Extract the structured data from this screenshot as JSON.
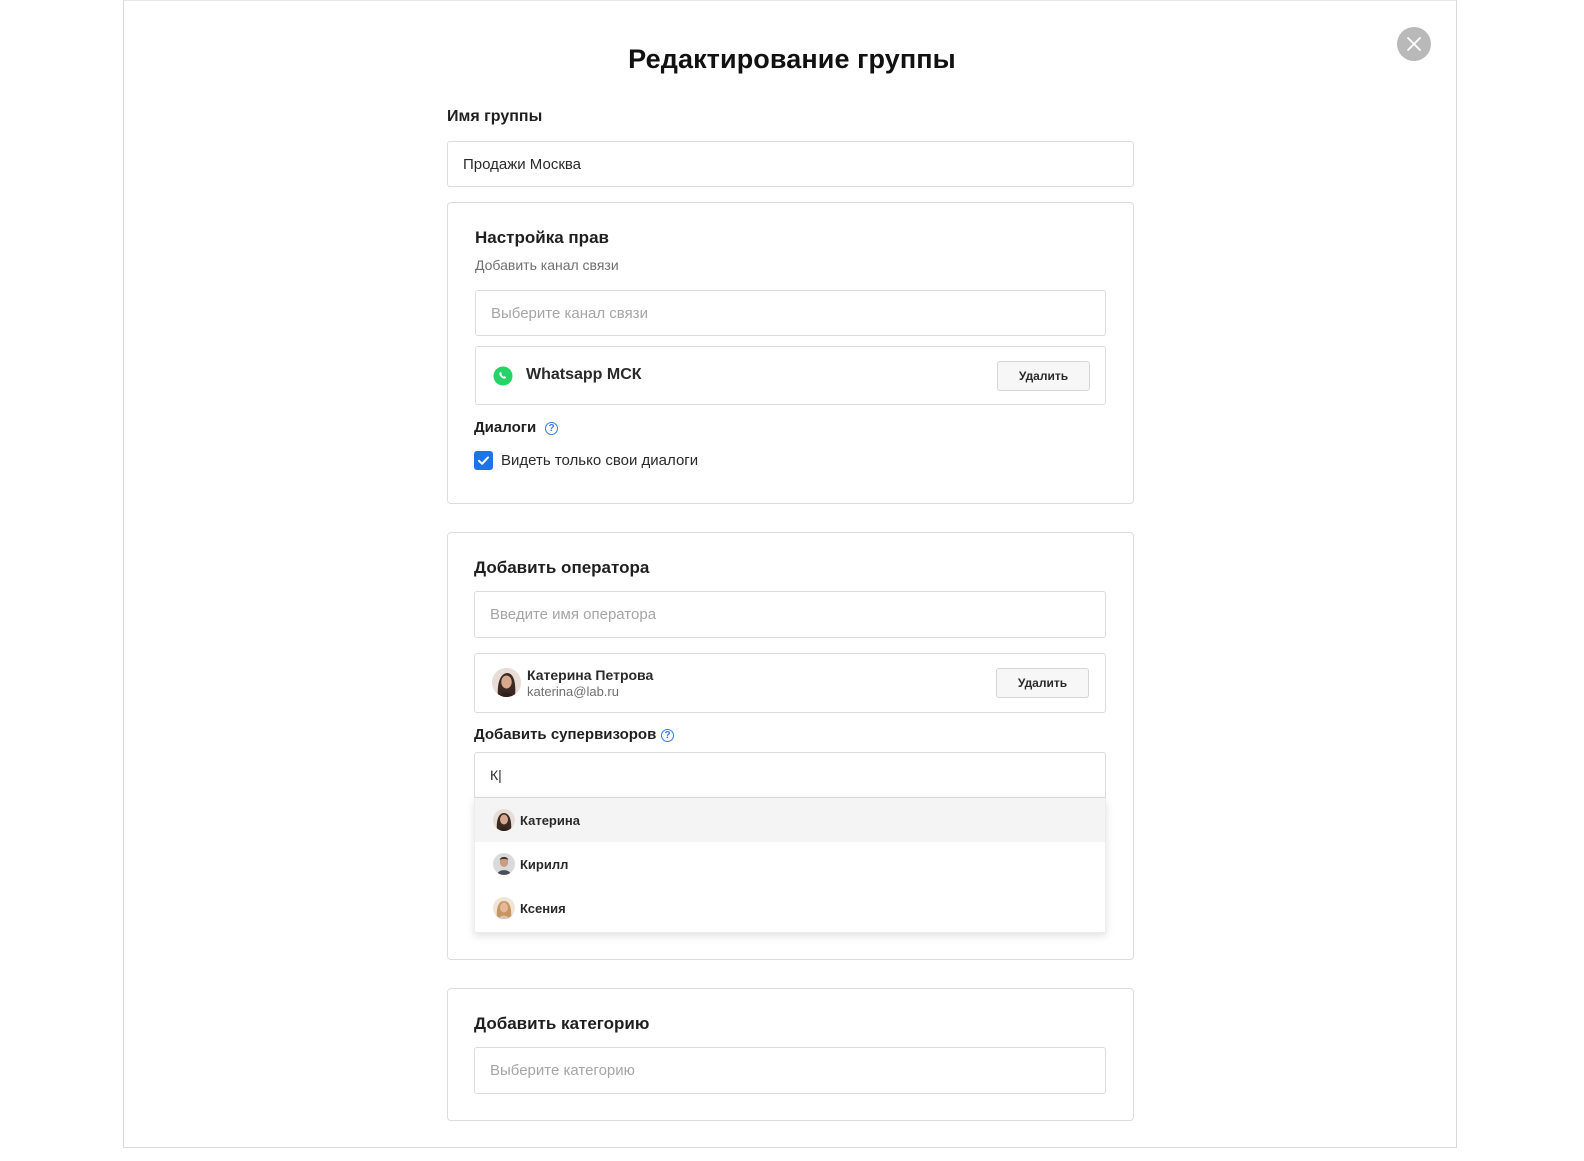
{
  "modal": {
    "title": "Редактирование группы",
    "close_icon": "close-icon"
  },
  "group_name": {
    "label": "Имя группы",
    "value": "Продажи Москва"
  },
  "rights": {
    "title": "Настройка прав",
    "subtitle": "Добавить канал связи",
    "channel_placeholder": "Выберите канал связи",
    "channel": {
      "icon": "whatsapp-icon",
      "name": "Whatsapp МСК",
      "delete_label": "Удалить"
    },
    "dialogs_label": "Диалоги",
    "help_icon": "?",
    "only_own_label": "Видеть только свои диалоги",
    "only_own_checked": true
  },
  "operator": {
    "title": "Добавить оператора",
    "placeholder": "Введите имя оператора",
    "item": {
      "name": "Катерина Петрова",
      "email": "katerina@lab.ru",
      "delete_label": "Удалить"
    },
    "supervisors_label": "Добавить супервизоров",
    "supervisor_input_value": "К|",
    "suggestions": [
      {
        "name": "Катерина",
        "active": true
      },
      {
        "name": "Кирилл",
        "active": false
      },
      {
        "name": "Ксения",
        "active": false
      }
    ]
  },
  "category": {
    "title": "Добавить категорию",
    "placeholder": "Выберите категорию"
  },
  "colors": {
    "accent": "#1d74e6",
    "whatsapp": "#25d366",
    "close_bg": "#b9b9b9"
  }
}
